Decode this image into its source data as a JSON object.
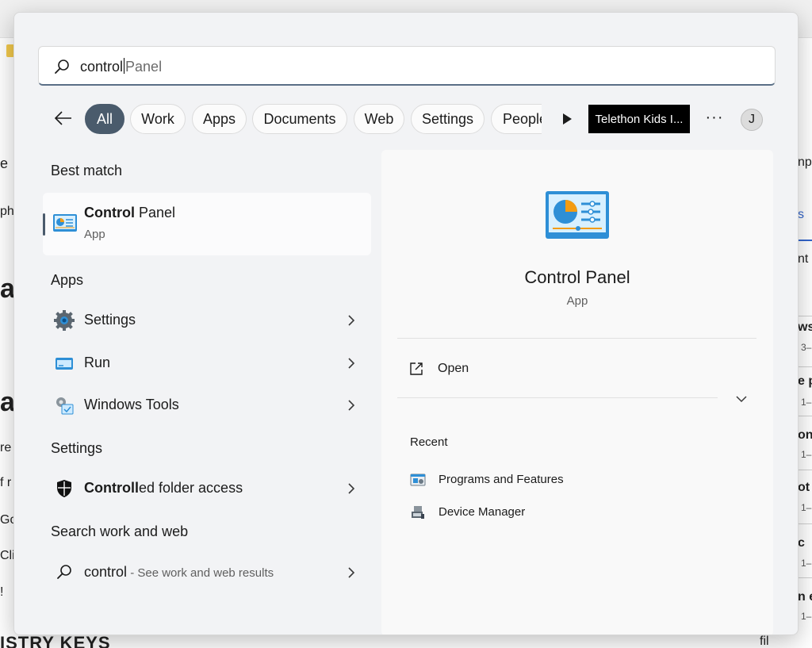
{
  "background": {
    "left_snippets": [
      "e",
      "ph",
      "a",
      "a",
      "re",
      "f r",
      "Go",
      "Clic",
      "!"
    ],
    "right_snippets": [
      "npo",
      "s",
      "nt",
      "ws",
      "3–",
      "e p",
      "1–",
      "on",
      "1–",
      "ot",
      "1–",
      "c",
      "1–",
      "n e",
      "1–",
      "fil"
    ],
    "bottom_heading": "ISTRY KEYS"
  },
  "search": {
    "typed": "control",
    "suggestion": "Panel"
  },
  "filters": {
    "chips": [
      "All",
      "Work",
      "Apps",
      "Documents",
      "Web",
      "Settings",
      "People"
    ],
    "org": "Telethon Kids I...",
    "more": "···",
    "avatar_initial": "J"
  },
  "best_match": {
    "section_title": "Best match",
    "name_bold": "Control",
    "name_rest": " Panel",
    "type": "App"
  },
  "apps": {
    "section_title": "Apps",
    "items": [
      {
        "label": "Settings"
      },
      {
        "label": "Run"
      },
      {
        "label": "Windows Tools"
      }
    ]
  },
  "settings": {
    "section_title": "Settings",
    "item_bold": "Controll",
    "item_rest": "ed folder access"
  },
  "web": {
    "section_title": "Search work and web",
    "query": "control",
    "hint": " - See work and web results"
  },
  "details": {
    "name": "Control Panel",
    "type": "App",
    "open_label": "Open",
    "recent_title": "Recent",
    "recent": [
      "Programs and Features",
      "Device Manager"
    ]
  },
  "colors": {
    "active_chip": "#4a5b6c",
    "panel": "#f2f3f5",
    "accent_blue": "#2e8fd6"
  }
}
